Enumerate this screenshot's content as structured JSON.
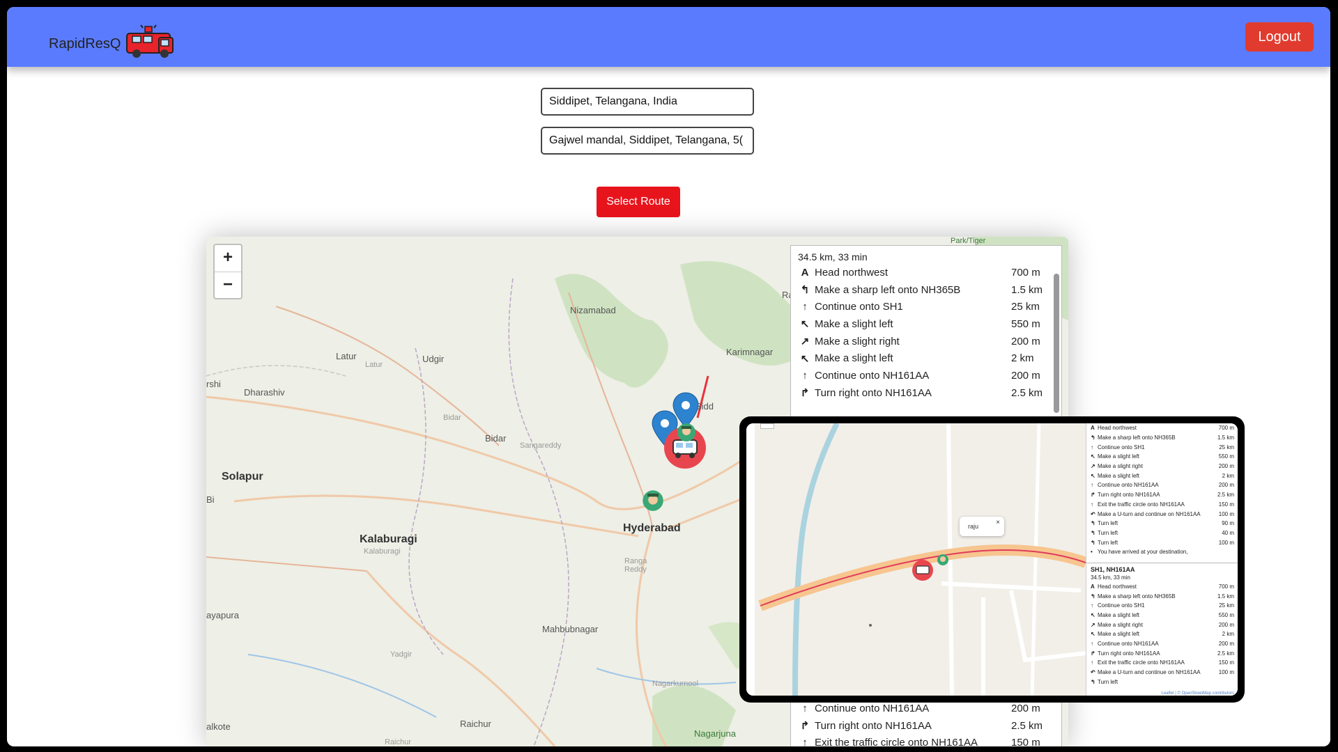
{
  "navbar": {
    "brand": "RapidResQ",
    "logout_label": "Logout",
    "color": "#5b7bff"
  },
  "form": {
    "origin_value": "Siddipet, Telangana, India",
    "destination_value": "Gajwel mandal, Siddipet, Telangana, 5(",
    "select_route_label": "Select Route"
  },
  "map": {
    "labels": {
      "nizamabad": "Nizamabad",
      "karimnagar": "Karimnagar",
      "latur": "Latur",
      "latur2": "Latur",
      "udgir": "Udgir",
      "dharashiv": "Dharashiv",
      "bidar": "Bidar",
      "bidar2": "Bidar",
      "sangareddy": "Sangareddy",
      "solapur": "Solapur",
      "kalaburagi": "Kalaburagi",
      "kalaburagi2": "Kalaburagi",
      "hyderabad": "Hyderabad",
      "ranga_reddy": "Ranga\nReddy",
      "mahbubnagar": "Mahbubnagar",
      "yadgir": "Yadgir",
      "raichur": "Raichur",
      "raichur2": "Raichur",
      "nagarkurnool": "Nagarkurnool",
      "nagarjuna": "Nagarjuna",
      "vijayapura": "ayapura",
      "alkote": "alkote",
      "siddipet": "Sidd",
      "park_tiger": "Park/Tiger",
      "rs": "Ra",
      "bs": "Bi",
      "rshi": "rshi"
    },
    "zoom_in": "+",
    "zoom_out": "−"
  },
  "directions": {
    "summary": "34.5 km, 33 min",
    "steps": [
      {
        "icon": "A",
        "text": "Head northwest",
        "dist": "700 m"
      },
      {
        "icon": "↰",
        "text": "Make a sharp left onto NH365B",
        "dist": "1.5 km"
      },
      {
        "icon": "↑",
        "text": "Continue onto SH1",
        "dist": "25 km"
      },
      {
        "icon": "↖",
        "text": "Make a slight left",
        "dist": "550 m"
      },
      {
        "icon": "↗",
        "text": "Make a slight right",
        "dist": "200 m"
      },
      {
        "icon": "↖",
        "text": "Make a slight left",
        "dist": "2 km"
      },
      {
        "icon": "↑",
        "text": "Continue onto NH161AA",
        "dist": "200 m"
      },
      {
        "icon": "↱",
        "text": "Turn right onto NH161AA",
        "dist": "2.5 km"
      }
    ],
    "bottom_steps": [
      {
        "icon": "↑",
        "text": "Continue onto NH161AA",
        "dist": "200 m"
      },
      {
        "icon": "↱",
        "text": "Turn right onto NH161AA",
        "dist": "2.5 km"
      },
      {
        "icon": "↑",
        "text": "Exit the traffic circle onto NH161AA",
        "dist": "150 m"
      }
    ]
  },
  "overlay": {
    "popup_text": "raju",
    "route_name": "SH1, NH161AA",
    "route_summary": "34.5 km, 33 min",
    "attribution": "Leaflet | © OpenStreetMap contributors",
    "steps_top": [
      {
        "icon": "A",
        "text": "Head northwest",
        "dist": "700 m"
      },
      {
        "icon": "↰",
        "text": "Make a sharp left onto NH365B",
        "dist": "1.5 km"
      },
      {
        "icon": "↑",
        "text": "Continue onto SH1",
        "dist": "25 km"
      },
      {
        "icon": "↖",
        "text": "Make a slight left",
        "dist": "550 m"
      },
      {
        "icon": "↗",
        "text": "Make a slight right",
        "dist": "200 m"
      },
      {
        "icon": "↖",
        "text": "Make a slight left",
        "dist": "2 km"
      },
      {
        "icon": "↑",
        "text": "Continue onto NH161AA",
        "dist": "200 m"
      },
      {
        "icon": "↱",
        "text": "Turn right onto NH161AA",
        "dist": "2.5 km"
      },
      {
        "icon": "↑",
        "text": "Exit the traffic circle onto NH161AA",
        "dist": "150 m"
      },
      {
        "icon": "↶",
        "text": "Make a U-turn and continue on NH161AA",
        "dist": "100 m"
      },
      {
        "icon": "↰",
        "text": "Turn left",
        "dist": "90 m"
      },
      {
        "icon": "↰",
        "text": "Turn left",
        "dist": "40 m"
      },
      {
        "icon": "↰",
        "text": "Turn left",
        "dist": "100 m"
      },
      {
        "icon": "•",
        "text": "You have arrived at your destination,",
        "dist": ""
      }
    ],
    "steps_bottom": [
      {
        "icon": "A",
        "text": "Head northwest",
        "dist": "700 m"
      },
      {
        "icon": "↰",
        "text": "Make a sharp left onto NH365B",
        "dist": "1.5 km"
      },
      {
        "icon": "↑",
        "text": "Continue onto SH1",
        "dist": "25 km"
      },
      {
        "icon": "↖",
        "text": "Make a slight left",
        "dist": "550 m"
      },
      {
        "icon": "↗",
        "text": "Make a slight right",
        "dist": "200 m"
      },
      {
        "icon": "↖",
        "text": "Make a slight left",
        "dist": "2 km"
      },
      {
        "icon": "↑",
        "text": "Continue onto NH161AA",
        "dist": "200 m"
      },
      {
        "icon": "↱",
        "text": "Turn right onto NH161AA",
        "dist": "2.5 km"
      },
      {
        "icon": "↑",
        "text": "Exit the traffic circle onto NH161AA",
        "dist": "150 m"
      },
      {
        "icon": "↶",
        "text": "Make a U-turn and continue on NH161AA",
        "dist": "100 m"
      },
      {
        "icon": "↰",
        "text": "Turn left",
        "dist": ""
      }
    ]
  }
}
